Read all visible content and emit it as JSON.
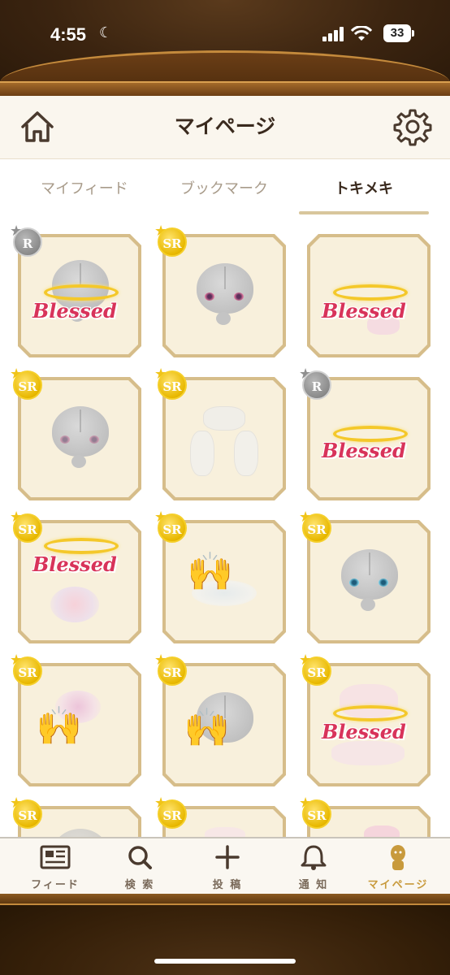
{
  "status_bar": {
    "time": "4:55",
    "battery": "33"
  },
  "header": {
    "title": "マイページ"
  },
  "tabs": [
    {
      "label": "マイフィード",
      "active": false
    },
    {
      "label": "ブックマーク",
      "active": false
    },
    {
      "label": "トキメキ",
      "active": true
    }
  ],
  "cards": [
    {
      "rarity": "R",
      "content": "halo-blessed-head"
    },
    {
      "rarity": "SR",
      "content": "head-pink-eyes"
    },
    {
      "rarity": "",
      "content": "halo-blessed-hair"
    },
    {
      "rarity": "SR",
      "content": "head-pink-eyes-faint"
    },
    {
      "rarity": "SR",
      "content": "white-twin-tails"
    },
    {
      "rarity": "R",
      "content": "halo-blessed"
    },
    {
      "rarity": "SR",
      "content": "halo-blessed-flowers"
    },
    {
      "rarity": "SR",
      "content": "raised-hands"
    },
    {
      "rarity": "SR",
      "content": "head-blue-eyes"
    },
    {
      "rarity": "SR",
      "content": "raised-hands-flowers"
    },
    {
      "rarity": "SR",
      "content": "head-raised-hands"
    },
    {
      "rarity": "SR",
      "content": "halo-blessed-pink-hair"
    },
    {
      "rarity": "SR",
      "content": "partial"
    },
    {
      "rarity": "SR",
      "content": "partial"
    },
    {
      "rarity": "SR",
      "content": "partial"
    }
  ],
  "card_text": {
    "blessed": "Blessed"
  },
  "bottom_nav": [
    {
      "label": "フィード",
      "icon": "feed-icon",
      "active": false
    },
    {
      "label": "検 索",
      "icon": "search-icon",
      "active": false
    },
    {
      "label": "投 稿",
      "icon": "plus-icon",
      "active": false
    },
    {
      "label": "通 知",
      "icon": "bell-icon",
      "active": false
    },
    {
      "label": "マイページ",
      "icon": "person-icon",
      "active": true
    }
  ],
  "colors": {
    "accent_gold": "#c89a3c",
    "badge_sr": "#e8b800",
    "badge_r": "#8a8a8a",
    "blessed_text": "#d8335a"
  }
}
